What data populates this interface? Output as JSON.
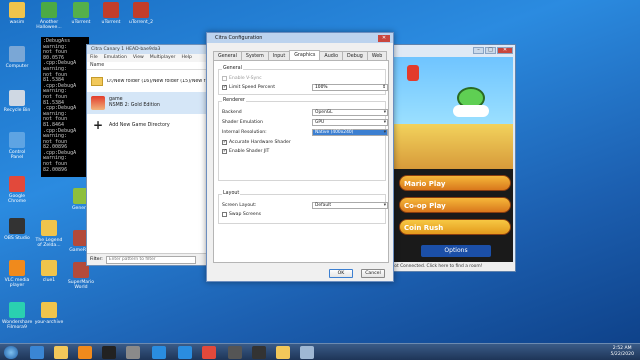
{
  "desktop": {
    "icons": [
      {
        "label": "wasim",
        "color": "#f0c44c"
      },
      {
        "label": "Another Hallowee...",
        "color": "#4caa44"
      },
      {
        "label": "uTorrent",
        "color": "#55b04a"
      },
      {
        "label": "uTorrent",
        "color": "#c23d2a"
      },
      {
        "label": "uTorrent_2",
        "color": "#c23d2a"
      },
      {
        "label": "Computer",
        "color": "#7aa7d6"
      },
      {
        "label": "Recycle Bin",
        "color": "#cfd8e3"
      },
      {
        "label": "Control Panel",
        "color": "#5ea4e3"
      },
      {
        "label": "Google Chrome",
        "color": "#e2493b"
      },
      {
        "label": "OBS Studio",
        "color": "#333"
      },
      {
        "label": "VLC media player",
        "color": "#f08a1c"
      },
      {
        "label": "Wondershare Filmora9",
        "color": "#2ad0b0"
      },
      {
        "label": "General",
        "color": "#8dbf3d"
      },
      {
        "label": "The Legend of Zelda...",
        "color": "#f0c44c"
      },
      {
        "label": "clue1",
        "color": "#f0c44c"
      },
      {
        "label": "your-archive",
        "color": "#f0c44c"
      },
      {
        "label": "GameRGB",
        "color": "#b34a3a"
      },
      {
        "label": "SuperMario World",
        "color": "#b34a3a"
      }
    ]
  },
  "console": {
    "lines": [
      ":DebugAss",
      "warning:",
      "not foun",
      "80.0576",
      ".cpp:DebugA",
      "warning:",
      "not foun",
      "81.5384",
      ".cpp:DebugA",
      "warning:",
      "not foun",
      "81.5384",
      ".cpp:DebugA",
      "warning:",
      "not foun",
      "81.8464",
      ".cpp:DebugA",
      "warning:",
      "not foun",
      "82.00896",
      ".cpp:DebugA",
      "warning:",
      "not foun",
      "82.00896"
    ]
  },
  "citra_main": {
    "title": "Citra Canary 1 HEAD-bae9da3",
    "menu": [
      "File",
      "Emulation",
      "View",
      "Multiplayer",
      "Help"
    ],
    "column_name": "Name",
    "rows": [
      {
        "path": "D:/New folder (16)/New folder (15)/New f"
      },
      {
        "title": "game",
        "subtitle": "NSMB 2: Gold Edition"
      },
      {
        "title": "Add New Game Directory"
      }
    ],
    "filter_label": "Filter:",
    "filter_placeholder": "Enter pattern to filter"
  },
  "game_window": {
    "buttons": [
      "Mario Play",
      "Co-op Play",
      "Coin Rush",
      "Options"
    ],
    "status": "Not Connected. Click here to find a room!"
  },
  "config": {
    "title": "Citra Configuration",
    "tabs": [
      "General",
      "System",
      "Input",
      "Graphics",
      "Audio",
      "Debug",
      "Web"
    ],
    "active_tab": "Graphics",
    "general_group": "General",
    "enable_vsync": "Enable V-Sync",
    "limit_speed": "Limit Speed Percent",
    "limit_speed_value": "100%",
    "renderer_group": "Renderer",
    "backend_label": "Backend",
    "backend_value": "OpenGL",
    "shader_emulation_label": "Shader Emulation",
    "shader_emulation_value": "GPU",
    "internal_res_label": "Internal Resolution:",
    "internal_res_value": "Native (400x240)",
    "accurate_hw_shader": "Accurate Hardware Shader",
    "enable_shader_jit": "Enable Shader JIT",
    "layout_group": "Layout",
    "screen_layout_label": "Screen Layout:",
    "screen_layout_value": "Default",
    "swap_screens": "Swap Screens",
    "ok_label": "OK",
    "cancel_label": "Cancel"
  },
  "taskbar": {
    "time": "2:52 AM",
    "date": "5/22/2020"
  }
}
